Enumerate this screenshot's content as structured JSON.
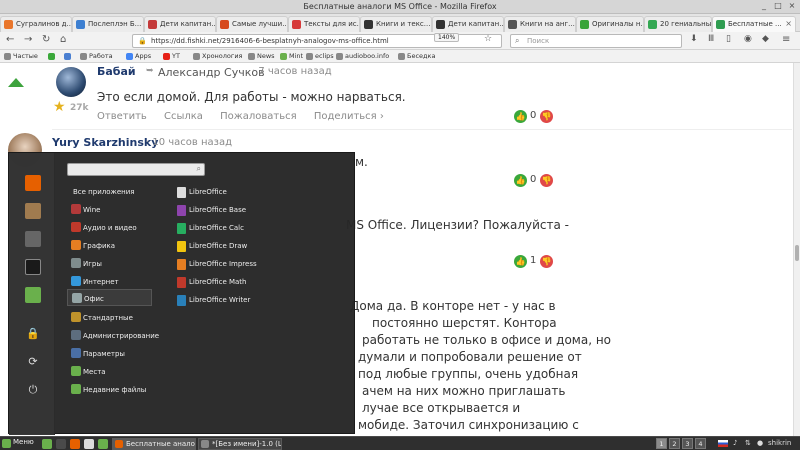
{
  "window": {
    "title": "Бесплатные аналоги MS Office - Mozilla Firefox",
    "controls": [
      "_",
      "□",
      "×"
    ]
  },
  "tabs": [
    {
      "label": "Сугралинов д...",
      "color": "#e9762b"
    },
    {
      "label": "Послеплэн Б...",
      "color": "#3d7fd1"
    },
    {
      "label": "Дети капитан...",
      "color": "#c43a3a"
    },
    {
      "label": "Самые лучши...",
      "color": "#d64a1e"
    },
    {
      "label": "Тексты для ис...",
      "color": "#d63a3a"
    },
    {
      "label": "Книги и текс...",
      "color": "#333333"
    },
    {
      "label": "Дети капитан...",
      "color": "#333333"
    },
    {
      "label": "Книги на анг...",
      "color": "#555555"
    },
    {
      "label": "Оригиналы н...",
      "color": "#3aa43a"
    },
    {
      "label": "20 гениальны...",
      "color": "#34a853"
    },
    {
      "label": "Бесплатные ...",
      "color": "#2f9d51",
      "active": true
    }
  ],
  "nav": {
    "url": "https://dd.fishki.net/2916406-6-besplatnyh-analogov-ms-office.html",
    "zoom": "140%",
    "search_placeholder": "Поиск"
  },
  "bookmarks": [
    {
      "label": "Частые",
      "color": "#888888"
    },
    {
      "label": "",
      "color": "#3aa83a"
    },
    {
      "label": "",
      "color": "#4a7fd1"
    },
    {
      "label": "Работа",
      "color": "#888888"
    },
    {
      "label": "Apps",
      "color": "#4285f4"
    },
    {
      "label": "YT",
      "color": "#e62117"
    },
    {
      "label": "Хронология",
      "color": "#888888"
    },
    {
      "label": "News",
      "color": "#888888"
    },
    {
      "label": "Mint",
      "color": "#6ab04c"
    },
    {
      "label": "eclips",
      "color": "#888888"
    },
    {
      "label": "audioboo.info",
      "color": "#888888"
    },
    {
      "label": "Беседка",
      "color": "#888888"
    }
  ],
  "comments": [
    {
      "author": "Бабай",
      "reply_to": "Александр Сучков",
      "time": "· 7 часов назад",
      "text": "Это если домой. Для работы - можно нарваться.",
      "actions": [
        "Ответить",
        "Ссылка",
        "Пожаловаться",
        "Поделиться ›"
      ],
      "votes": "0",
      "rating": "27k"
    },
    {
      "author": "Yury Skarzhinsky",
      "time": "· 10 часов назад",
      "text": "м.",
      "votes": "0"
    }
  ],
  "partial_text": {
    "line1": "MS Office. Лицензии? Пожалуйста -",
    "line1_end": "",
    "votes3": "1",
    "para": [
      "Дома да. В конторе нет - у нас в",
      "постоянно шерстят. Контора",
      "работать не только в офисе и дома, но",
      "думали и попробовали решение от",
      "под любые группы, очень удобная",
      "ачем на них можно приглашать",
      "лучае все открывается и",
      "мобиде. Заточил синхронизацию с"
    ]
  },
  "start_menu": {
    "categories": [
      {
        "label": "Все приложения",
        "color": ""
      },
      {
        "label": "Wine",
        "color": "#b33a3a"
      },
      {
        "label": "Аудио и видео",
        "color": "#c0392b"
      },
      {
        "label": "Графика",
        "color": "#e67e22"
      },
      {
        "label": "Игры",
        "color": "#7f8c8d"
      },
      {
        "label": "Интернет",
        "color": "#3498db"
      },
      {
        "label": "Офис",
        "color": "#95a5a6",
        "selected": true
      },
      {
        "label": "Стандартные",
        "color": "#c0932b"
      },
      {
        "label": "Администрирование",
        "color": "#5d6d7e"
      },
      {
        "label": "Параметры",
        "color": "#4a6fa5"
      },
      {
        "label": "Места",
        "color": "#6ab04c"
      },
      {
        "label": "Недавние файлы",
        "color": "#6ab04c"
      }
    ],
    "apps": [
      {
        "label": "LibreOffice",
        "color": "#dddddd"
      },
      {
        "label": "LibreOffice Base",
        "color": "#8e44ad"
      },
      {
        "label": "LibreOffice Calc",
        "color": "#27ae60"
      },
      {
        "label": "LibreOffice Draw",
        "color": "#f1c40f"
      },
      {
        "label": "LibreOffice Impress",
        "color": "#e67e22"
      },
      {
        "label": "LibreOffice Math",
        "color": "#c0392b"
      },
      {
        "label": "LibreOffice Writer",
        "color": "#2980b9"
      }
    ],
    "favorites": [
      {
        "name": "firefox-icon",
        "color": "#e66000"
      },
      {
        "name": "software-manager-icon",
        "color": "#a07b4f"
      },
      {
        "name": "settings-icon",
        "color": "#666666"
      },
      {
        "name": "terminal-icon",
        "color": "#1a1a1a"
      },
      {
        "name": "files-icon",
        "color": "#6ab04c"
      }
    ],
    "session_glyphs": {
      "lock": "🔒",
      "logout": "⟳",
      "power": "⏻"
    }
  },
  "taskbar": {
    "menu_label": "Меню",
    "launchers": [
      "#6ab04c",
      "#4a4a4a",
      "#e66000",
      "#ddd",
      "#6ab04c"
    ],
    "windows": [
      {
        "label": "Бесплатные аналог...",
        "color": "#e66000",
        "active": true
      },
      {
        "label": "*[Без имени]-1.0 (Ц...",
        "color": "#888888"
      }
    ],
    "workspaces": [
      "1",
      "2",
      "3",
      "4"
    ],
    "user": "shikrin"
  }
}
